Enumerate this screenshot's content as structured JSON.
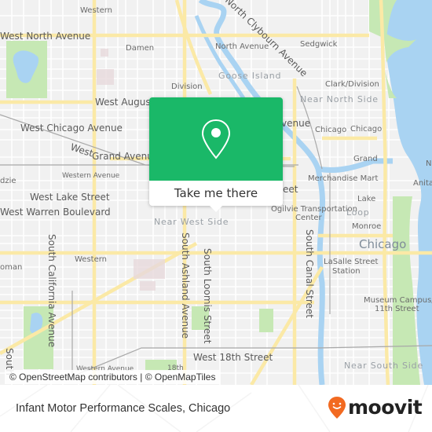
{
  "map": {
    "colors": {
      "background": "#f1f1f1",
      "water": "#a9d3f2",
      "park": "#c6e8b4",
      "major_road": "#fbe9a6",
      "minor_road": "#ffffff",
      "rail": "#a8a8a8",
      "accent": "#1ab868",
      "brand": "#f26a21"
    },
    "labels": {
      "western_n": "Western",
      "west_north_avenue": "West North Avenue",
      "damen": "Damen",
      "north_avenue": "North Avenue",
      "north_clybourn_avenue": "North Clybourn Avenue",
      "sedgwick": "Sedgwick",
      "goose_island": "Goose Island",
      "clark_division": "Clark/Division",
      "division": "Division",
      "west_augusta": "West Augusta",
      "near_north_side": "Near North Side",
      "avenue_partial": "venue",
      "west_chicago_avenue": "West Chicago Avenue",
      "chicago_1": "Chicago",
      "chicago_2": "Chicago",
      "west_word": "West",
      "grand_avenue": "Grand Avenue",
      "grand": "Grand",
      "western_avenue_top": "Western Avenue",
      "kedzie_partial": "dzie",
      "merchandise_mart": "Merchandise Mart",
      "anita_partial": "Anita",
      "na_partial": "Na",
      "west_lake_street": "West Lake Street",
      "street_partial": "eet",
      "west_warren_boulevard": "West Warren Boulevard",
      "ogilvie_1": "Ogilvie Transportation",
      "ogilvie_2": "Center",
      "lake": "Lake",
      "loop": "Loop",
      "near_west_side": "Near West Side",
      "monroe": "Monroe",
      "chicago_big": "Chicago",
      "roman_partial": "oman",
      "western_s": "Western",
      "south_california_avenue": "South California Avenue",
      "south_ashland_avenue": "South Ashland Avenue",
      "south_loomis_street": "South Loomis Street",
      "south_canal_street": "South Canal Street",
      "lasalle_1": "LaSalle Street",
      "lasalle_2": "Station",
      "museum_1": "Museum Campus/",
      "museum_2": "11th Street",
      "south_partial": "South",
      "west_18th_street": "West 18th Street",
      "western_avenue_bottom": "Western Avenue",
      "eighteenth": "18th",
      "near_south_side": "Near South Side"
    },
    "popup": {
      "icon": "map-pin-icon",
      "button_label": "Take me there"
    },
    "attribution": "© OpenStreetMap contributors | © OpenMapTiles"
  },
  "footer": {
    "title": "Infant Motor Performance Scales, Chicago",
    "logo_icon": "moovit-pin-icon",
    "logo_text": "moovit"
  }
}
